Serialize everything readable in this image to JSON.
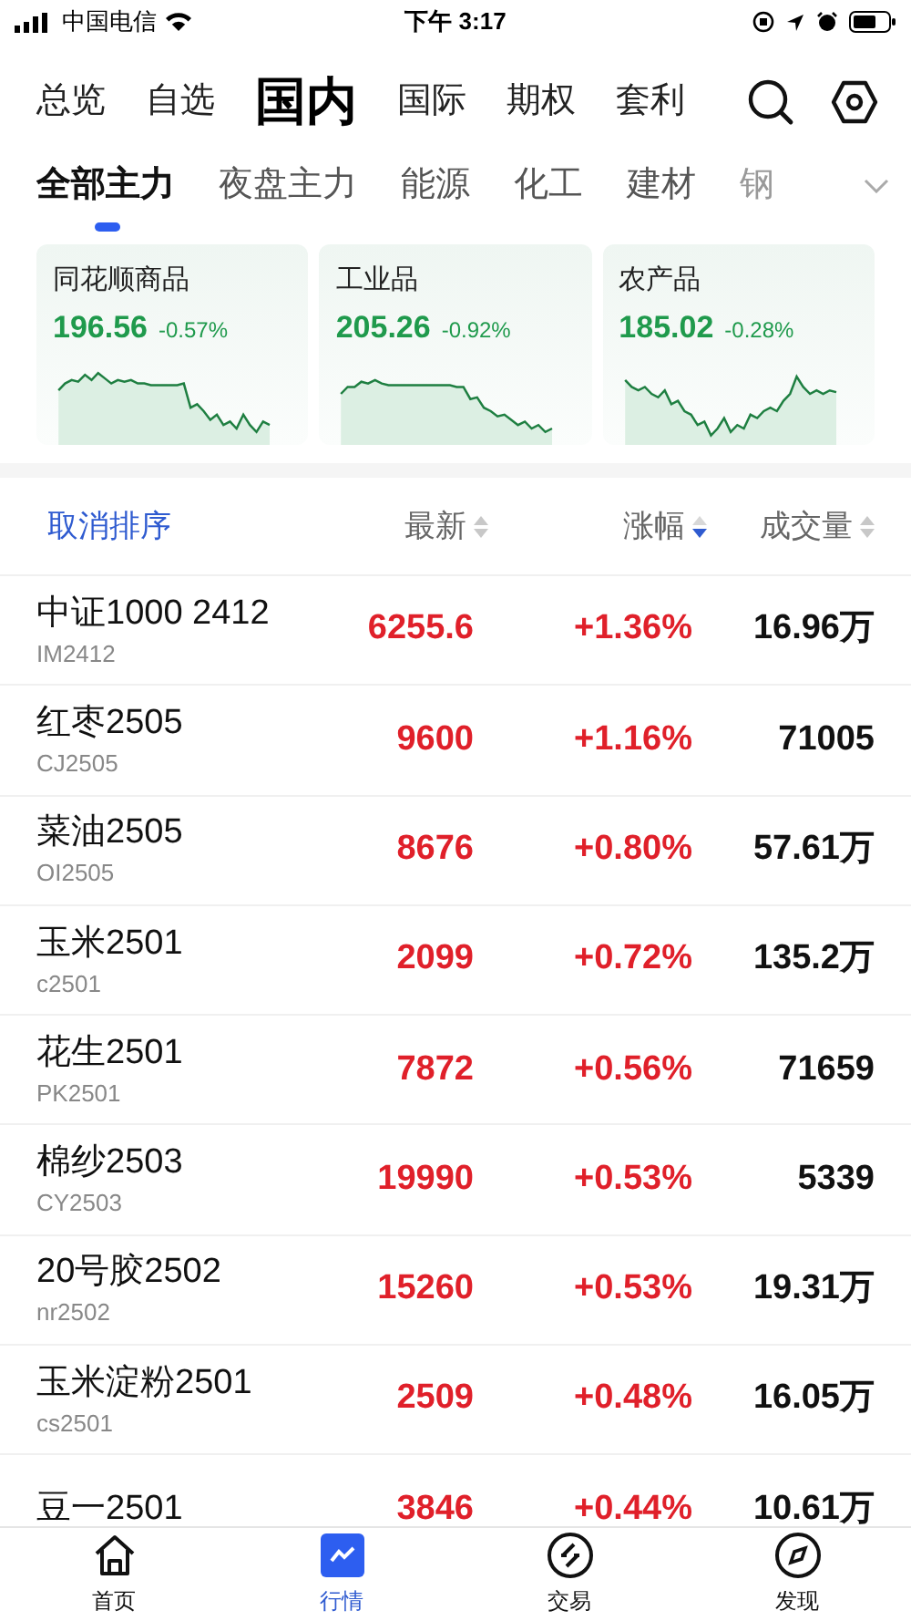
{
  "status_bar": {
    "carrier": "中国电信",
    "time": "下午 3:17"
  },
  "top_tabs": [
    {
      "label": "总览",
      "selected": false
    },
    {
      "label": "自选",
      "selected": false
    },
    {
      "label": "国内",
      "selected": true
    },
    {
      "label": "国际",
      "selected": false
    },
    {
      "label": "期权",
      "selected": false
    },
    {
      "label": "套利",
      "selected": false
    }
  ],
  "sub_tabs": [
    {
      "label": "全部主力",
      "selected": true
    },
    {
      "label": "夜盘主力",
      "selected": false
    },
    {
      "label": "能源",
      "selected": false
    },
    {
      "label": "化工",
      "selected": false
    },
    {
      "label": "建材",
      "selected": false
    },
    {
      "label": "钢",
      "selected": false
    }
  ],
  "index_cards": [
    {
      "name": "同花顺商品",
      "value": "196.56",
      "change": "-0.57%"
    },
    {
      "name": "工业品",
      "value": "205.26",
      "change": "-0.92%"
    },
    {
      "name": "农产品",
      "value": "185.02",
      "change": "-0.28%"
    }
  ],
  "table": {
    "cancel_sort": "取消排序",
    "columns": [
      {
        "label": "最新",
        "sorted_descending": false
      },
      {
        "label": "涨幅",
        "sorted_descending": true
      },
      {
        "label": "成交量",
        "sorted_descending": false
      }
    ],
    "rows": [
      {
        "name": "中证1000 2412",
        "code": "IM2412",
        "price": "6255.6",
        "change": "+1.36%",
        "volume": "16.96万"
      },
      {
        "name": "红枣2505",
        "code": "CJ2505",
        "price": "9600",
        "change": "+1.16%",
        "volume": "71005"
      },
      {
        "name": "菜油2505",
        "code": "OI2505",
        "price": "8676",
        "change": "+0.80%",
        "volume": "57.61万"
      },
      {
        "name": "玉米2501",
        "code": "c2501",
        "price": "2099",
        "change": "+0.72%",
        "volume": "135.2万"
      },
      {
        "name": "花生2501",
        "code": "PK2501",
        "price": "7872",
        "change": "+0.56%",
        "volume": "71659"
      },
      {
        "name": "棉纱2503",
        "code": "CY2503",
        "price": "19990",
        "change": "+0.53%",
        "volume": "5339"
      },
      {
        "name": "20号胶2502",
        "code": "nr2502",
        "price": "15260",
        "change": "+0.53%",
        "volume": "19.31万"
      },
      {
        "name": "玉米淀粉2501",
        "code": "cs2501",
        "price": "2509",
        "change": "+0.48%",
        "volume": "16.05万"
      },
      {
        "name": "豆一2501",
        "price": "3846",
        "change": "+0.44%",
        "volume": "10.61万"
      }
    ]
  },
  "bottom_nav": [
    {
      "label": "首页",
      "selected": false
    },
    {
      "label": "行情",
      "selected": true
    },
    {
      "label": "交易",
      "selected": false
    },
    {
      "label": "发现",
      "selected": false
    }
  ]
}
